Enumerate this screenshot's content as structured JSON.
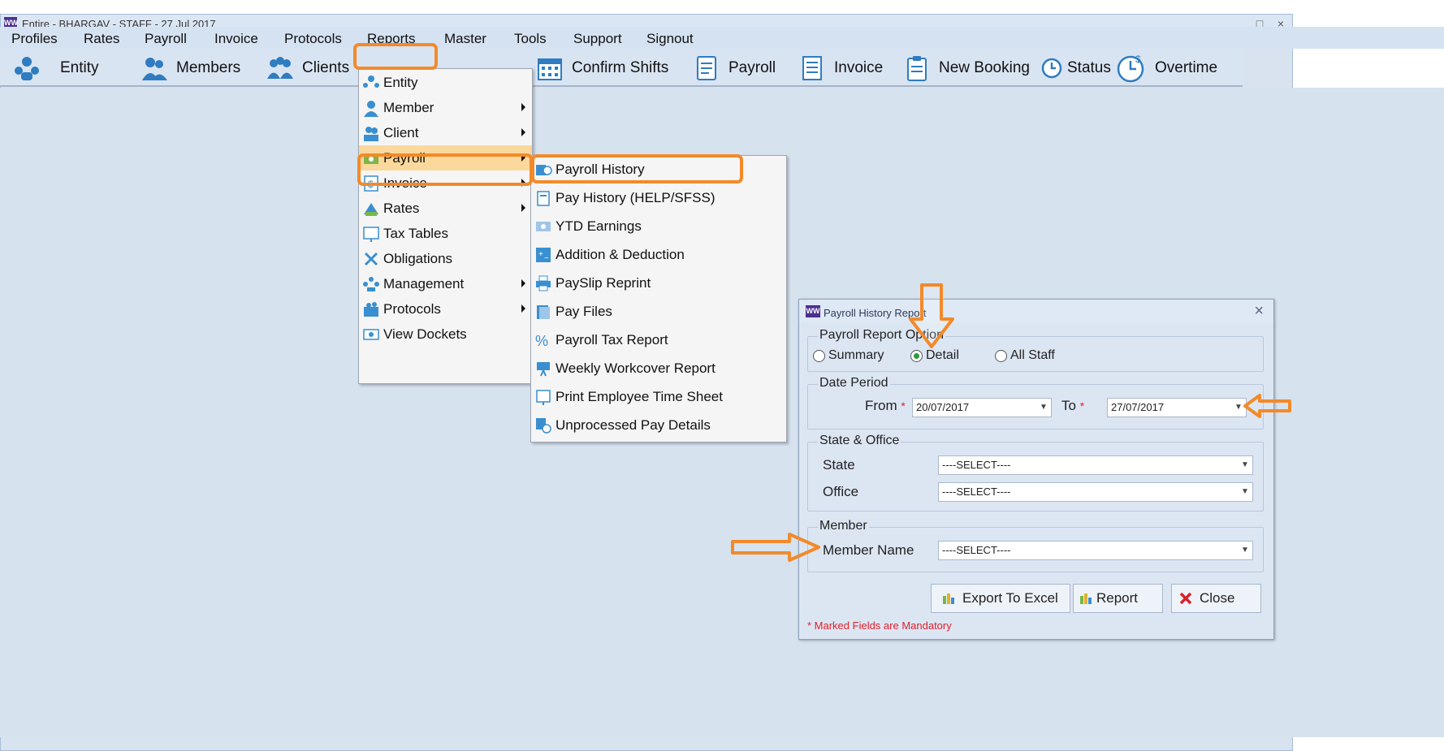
{
  "window": {
    "title": "Entire - BHARGAV - STAFF - 27 Jul 2017",
    "app_icon": "app-logo-icon",
    "controls": [
      "_",
      "□",
      "×"
    ]
  },
  "menubar": [
    "Profiles",
    "Rates",
    "Payroll",
    "Invoice",
    "Protocols",
    "Reports",
    "Master",
    "Tools",
    "Support",
    "Signout"
  ],
  "toolbar": {
    "entity": "Entity",
    "members": "Members",
    "clients": "Clients",
    "confirm_shifts": "Confirm Shifts",
    "payroll": "Payroll",
    "invoice": "Invoice",
    "new_booking": "New Booking",
    "status": "Status",
    "overtime": "Overtime"
  },
  "reports_menu": [
    "Entity",
    "Member",
    "Client",
    "Payroll",
    "Invoice",
    "Rates",
    "Tax Tables",
    "Obligations",
    "Management",
    "Protocols",
    "View Dockets"
  ],
  "payroll_submenu": [
    "Payroll History",
    "Pay History (HELP/SFSS)",
    "YTD Earnings",
    "Addition & Deduction",
    "PaySlip Reprint",
    "Pay Files",
    "Payroll Tax Report",
    "Weekly Workcover Report",
    "Print Employee Time Sheet",
    "Unprocessed Pay Details"
  ],
  "dialog": {
    "title": "Payroll History Report",
    "options_group": "Payroll Report Option",
    "opt_summary": "Summary",
    "opt_detail": "Detail",
    "opt_all_staff": "All Staff",
    "date_group": "Date Period",
    "from_label": "From",
    "from_value": "20/07/2017",
    "to_label": "To",
    "to_value": "27/07/2017",
    "state_group": "State & Office",
    "state_label": "State",
    "state_value": "----SELECT----",
    "office_label": "Office",
    "office_value": "----SELECT----",
    "member_group": "Member",
    "member_label": "Member Name",
    "member_value": "----SELECT----",
    "export_btn": "Export To Excel",
    "report_btn": "Report",
    "close_btn": "Close",
    "mandatory_note": "* Marked Fields are Mandatory",
    "required_mark": "*"
  },
  "colors": {
    "highlight": "#f28a2a",
    "menu_selected": "#fbd89c",
    "required": "#e0202a"
  }
}
